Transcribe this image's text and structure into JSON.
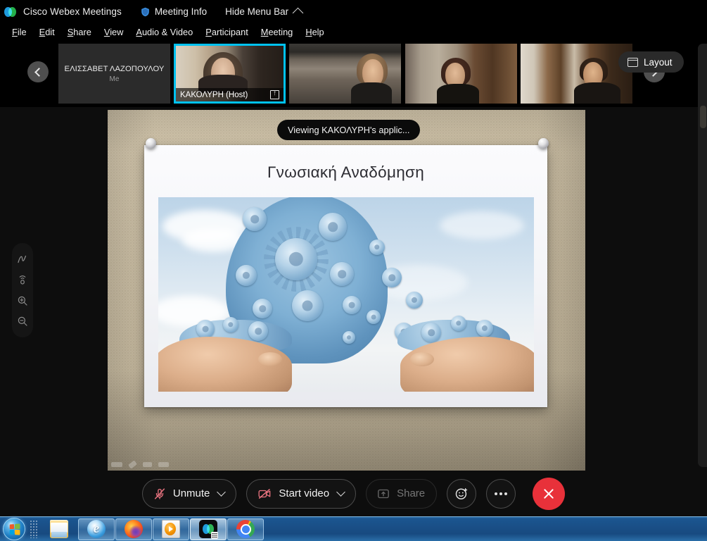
{
  "app": {
    "title": "Cisco Webex Meetings",
    "logo_icon": "webex-logo-icon"
  },
  "title_bar": {
    "meeting_info_label": "Meeting Info",
    "meeting_info_icon": "shield-icon",
    "hide_menu_label": "Hide Menu Bar",
    "hide_menu_icon": "chevron-up-icon"
  },
  "menu_bar": {
    "items": [
      {
        "label": "File",
        "mnemonic": "F"
      },
      {
        "label": "Edit",
        "mnemonic": "E"
      },
      {
        "label": "Share",
        "mnemonic": "S"
      },
      {
        "label": "View",
        "mnemonic": "V"
      },
      {
        "label": "Audio & Video",
        "mnemonic": "A"
      },
      {
        "label": "Participant",
        "mnemonic": "P"
      },
      {
        "label": "Meeting",
        "mnemonic": "M"
      },
      {
        "label": "Help",
        "mnemonic": "H"
      }
    ]
  },
  "filmstrip": {
    "nav_left_icon": "chevron-left-icon",
    "nav_right_icon": "chevron-right-icon",
    "layout_button_label": "Layout",
    "layout_button_icon": "layout-grid-icon",
    "participants": [
      {
        "name": "ΕΛΙΣΣΑΒΕΤ ΛΑΖΟΠΟΥΛΟΥ",
        "subtitle": "Me",
        "video_on": false,
        "active_speaker": false,
        "is_host": false,
        "sharing": false
      },
      {
        "name": "ΚΑΚΟΛΥΡΗ",
        "label": "ΚΑΚΟΛΥΡΗ  (Host)",
        "video_on": true,
        "active_speaker": true,
        "is_host": true,
        "sharing": true,
        "share_icon": "screen-share-icon"
      },
      {
        "name": "",
        "label": "",
        "video_on": true,
        "active_speaker": false,
        "is_host": false,
        "sharing": false
      },
      {
        "name": "",
        "label": "",
        "video_on": true,
        "active_speaker": false,
        "is_host": false,
        "sharing": false
      },
      {
        "name": "",
        "label": "",
        "video_on": true,
        "active_speaker": false,
        "is_host": false,
        "sharing": false
      }
    ]
  },
  "stage": {
    "viewing_badge": "Viewing ΚΑΚΟΛΥΡΗ's applic...",
    "slide": {
      "title": "Γνωσιακή Αναδόμηση",
      "image_alt": "blue gears forming a human head profile held in two open hands against a sky background"
    }
  },
  "annotation_toolbar": {
    "buttons": [
      {
        "name": "annotate-pen-tool",
        "icon": "pen-scribble-icon"
      },
      {
        "name": "laser-pointer-tool",
        "icon": "laser-pointer-icon"
      },
      {
        "name": "zoom-in-tool",
        "icon": "magnifier-plus-icon"
      },
      {
        "name": "zoom-out-tool",
        "icon": "magnifier-minus-icon"
      }
    ]
  },
  "control_bar": {
    "mute_label": "Unmute",
    "mute_icon": "microphone-muted-icon",
    "mute_state": "muted",
    "video_label": "Start video",
    "video_icon": "camera-off-icon",
    "video_state": "off",
    "share_label": "Share",
    "share_icon": "share-screen-icon",
    "share_enabled": false,
    "reactions_icon": "smiley-reaction-icon",
    "more_icon": "more-options-icon",
    "leave_icon": "close-x-icon",
    "dropdown_icon": "chevron-down-icon"
  },
  "right_panel": {
    "collapsed": true
  },
  "taskbar": {
    "start_label": "Start",
    "start_icon": "windows-logo-icon",
    "items": [
      {
        "name": "taskbar-item-explorer",
        "icon": "file-explorer-icon",
        "framed": false,
        "active": false
      },
      {
        "name": "taskbar-item-internet-explorer",
        "icon": "internet-explorer-icon",
        "framed": true,
        "active": false
      },
      {
        "name": "taskbar-item-firefox",
        "icon": "firefox-icon",
        "framed": true,
        "active": false
      },
      {
        "name": "taskbar-item-media-player",
        "icon": "windows-media-player-icon",
        "framed": true,
        "active": false
      },
      {
        "name": "taskbar-item-webex",
        "icon": "webex-icon",
        "framed": false,
        "active": true
      },
      {
        "name": "taskbar-item-chrome",
        "icon": "google-chrome-icon",
        "framed": true,
        "active": false
      }
    ]
  },
  "colors": {
    "accent_active_speaker": "#00c2f0",
    "leave_button": "#e8313a",
    "control_icon_warn": "#e8737f",
    "app_background": "#0d0d0d",
    "taskbar_blue": "#1a4f87"
  }
}
